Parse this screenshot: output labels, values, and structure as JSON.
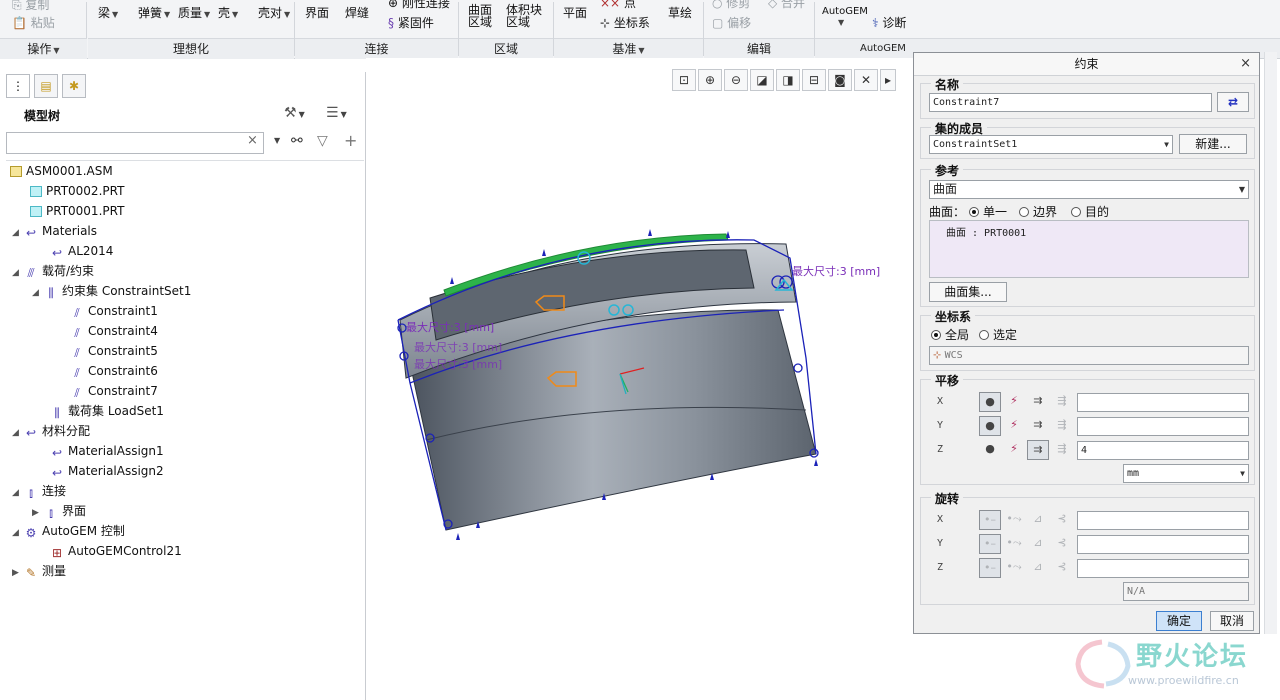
{
  "ribbon": {
    "top_left": [
      "复制",
      "粘贴"
    ],
    "idealize_items": [
      "梁",
      "弹簧",
      "质量",
      "壳",
      "壳对"
    ],
    "connect_items": [
      "界面",
      "焊缝",
      "刚性连接",
      "紧固件"
    ],
    "region_items": [
      "曲面区域",
      "体积块区域"
    ],
    "datum_items": [
      "平面",
      "点",
      "坐标系",
      "草绘"
    ],
    "edit_items": [
      "修剪",
      "偏移",
      "合并"
    ],
    "autogem_items": [
      "AutoGEM",
      "诊断"
    ],
    "groups": [
      "操作",
      "理想化",
      "连接",
      "区域",
      "基准",
      "编辑",
      "AutoGEM"
    ]
  },
  "model_tree": {
    "title": "模型树",
    "search_placeholder": "",
    "items": [
      {
        "label": "ASM0001.ASM"
      },
      {
        "label": "PRT0002.PRT"
      },
      {
        "label": "PRT0001.PRT"
      },
      {
        "label": "Materials"
      },
      {
        "label": "AL2014"
      },
      {
        "label": "载荷/约束"
      },
      {
        "label": "约束集 ConstraintSet1"
      },
      {
        "label": "Constraint1"
      },
      {
        "label": "Constraint4"
      },
      {
        "label": "Constraint5"
      },
      {
        "label": "Constraint6"
      },
      {
        "label": "Constraint7"
      },
      {
        "label": "载荷集 LoadSet1"
      },
      {
        "label": "材料分配"
      },
      {
        "label": "MaterialAssign1"
      },
      {
        "label": "MaterialAssign2"
      },
      {
        "label": "连接"
      },
      {
        "label": "界面"
      },
      {
        "label": "AutoGEM 控制"
      },
      {
        "label": "AutoGEMControl21"
      },
      {
        "label": "测量"
      }
    ]
  },
  "viewport": {
    "annotations": [
      "最大尺寸:3 [mm]",
      "最大尺寸:3 [mm]",
      "最大尺寸:3 [mm]",
      "最大尺寸:3 [mm]"
    ]
  },
  "dialog": {
    "title": "约束",
    "name_label": "名称",
    "name_value": "Constraint7",
    "set_label": "集的成员",
    "set_value": "ConstraintSet1",
    "new_button": "新建...",
    "ref_label": "参考",
    "ref_type": "曲面",
    "surface_label": "曲面：",
    "opt_single": "单一",
    "opt_boundary": "边界",
    "opt_target": "目的",
    "ref_entry": "曲面 : PRT0001",
    "surface_set_button": "曲面集...",
    "csys_label": "坐标系",
    "csys_global": "全局",
    "csys_selected": "选定",
    "csys_value": "WCS",
    "translation_label": "平移",
    "axis_x": "X",
    "axis_y": "Y",
    "axis_z": "Z",
    "z_value": "4",
    "unit": "mm",
    "rotation_label": "旋转",
    "rot_unit": "N/A",
    "ok_button": "确定",
    "cancel_button": "取消"
  },
  "watermark": {
    "text": "野火论坛",
    "url": "www.proewildfire.cn"
  }
}
